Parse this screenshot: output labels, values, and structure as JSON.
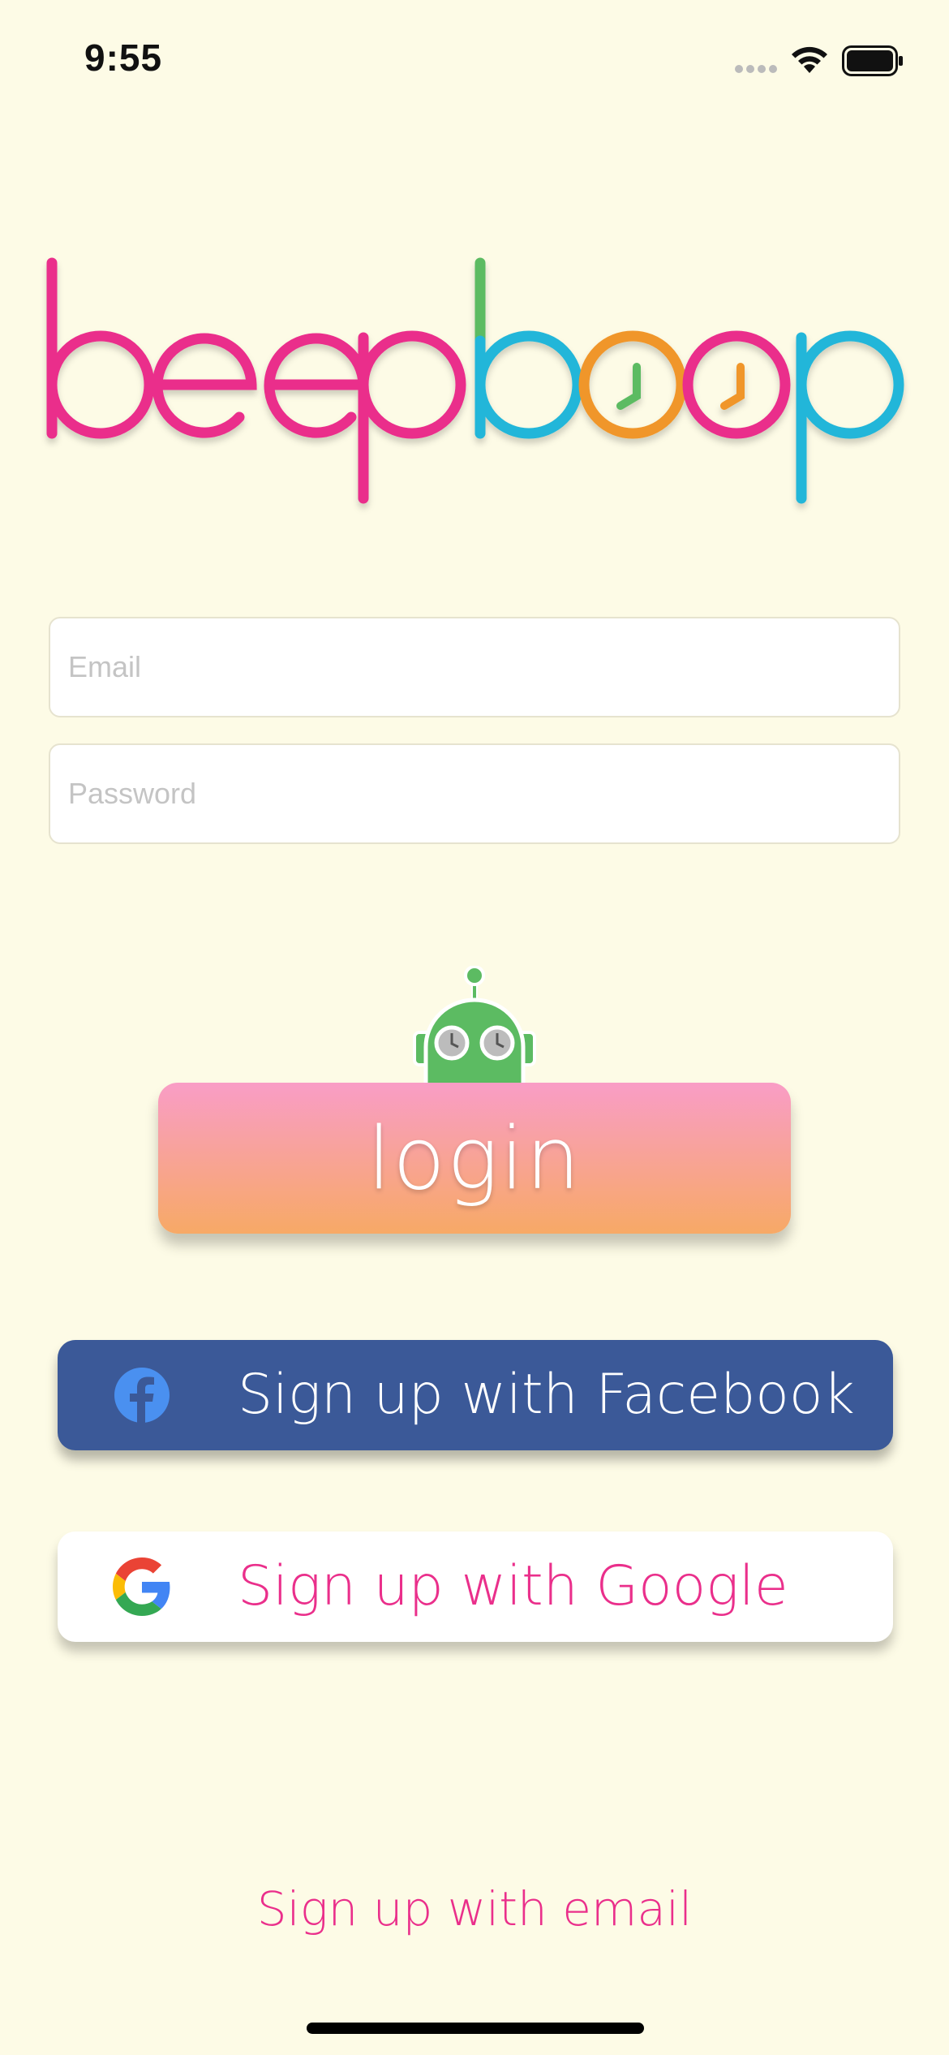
{
  "status_bar": {
    "time": "9:55"
  },
  "logo": {
    "text_left": "beep",
    "text_right": "boop"
  },
  "form": {
    "email_placeholder": "Email",
    "password_placeholder": "Password"
  },
  "login_button": {
    "label": "login"
  },
  "social": {
    "facebook_label": "Sign up with Facebook",
    "google_label": "Sign up with Google"
  },
  "email_signup_link": "Sign up with email",
  "colors": {
    "background": "#fdfbe6",
    "pink": "#ea2f8b",
    "blue": "#22b6d9",
    "orange": "#f0962c",
    "green": "#5cbb62",
    "facebook": "#3b5998"
  }
}
